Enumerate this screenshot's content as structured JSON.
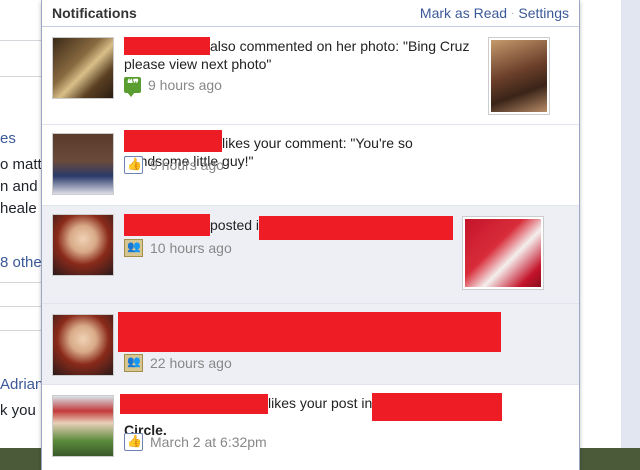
{
  "header": {
    "title": "Notifications",
    "mark_read": "Mark as Read",
    "separator": "·",
    "settings": "Settings"
  },
  "background_fragments": {
    "items": [
      "es",
      "o matt",
      "n and s",
      "heale",
      "8 othe",
      "Adrian",
      "k you"
    ]
  },
  "notifications": [
    {
      "text": "also commented on her photo: \"Bing Cruz please view next photo\"",
      "time": "9 hours ago",
      "icon": "comment-icon",
      "icon_glyph": "❝❞"
    },
    {
      "text": "likes your comment: \"You're so handsome little guy!\"",
      "time": "9 hours ago",
      "icon": "like-icon",
      "icon_glyph": "👍"
    },
    {
      "text": "posted i",
      "time": "10 hours ago",
      "icon": "group-icon",
      "icon_glyph": "👥"
    },
    {
      "text": "",
      "time": "22 hours ago",
      "icon": "group-icon",
      "icon_glyph": "👥"
    },
    {
      "text_a": "likes your post in",
      "text_b": "Circle.",
      "time": "March 2 at 6:32pm",
      "icon": "like-icon",
      "icon_glyph": "👍"
    }
  ],
  "colors": {
    "facebook_blue": "#3b5998",
    "unread_bg": "#edeff4",
    "redaction": "#ee1c25"
  }
}
